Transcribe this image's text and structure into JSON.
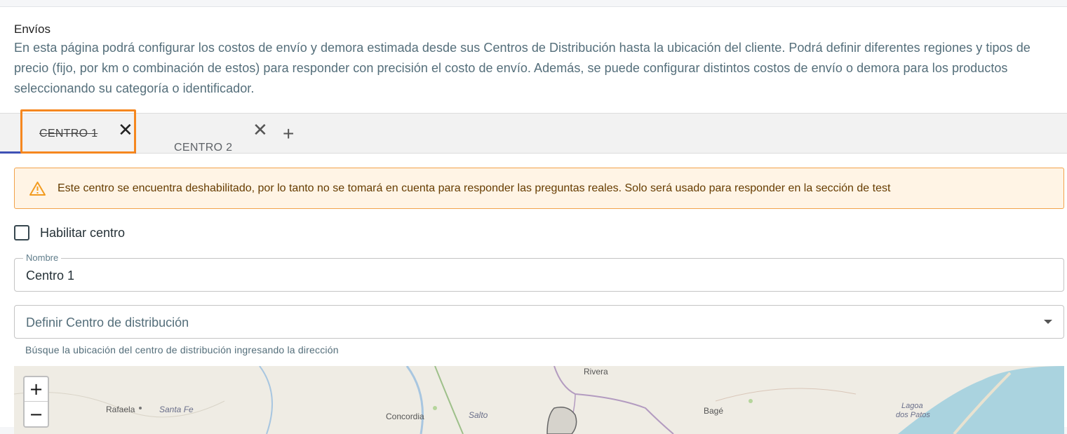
{
  "header": {
    "title": "Envíos",
    "description": "En esta página podrá configurar los costos de envío y demora estimada desde sus Centros de Distribución hasta la ubicación del cliente. Podrá definir diferentes regiones y tipos de precio (fijo, por km o combinación de estos) para responder con precisión el costo de envío. Además, se puede configurar distintos costos de envío o demora para los productos seleccionando su categoría o identificador."
  },
  "tabs": [
    {
      "label": "CENTRO 1",
      "close": "✕",
      "disabled": true,
      "selected": true
    },
    {
      "label": "CENTRO 2",
      "close": "✕",
      "disabled": false,
      "selected": false
    }
  ],
  "tab_add": "+",
  "alert": {
    "icon": "warning-icon",
    "text": "Este centro se encuentra deshabilitado, por lo tanto no se tomará en cuenta para responder las preguntas reales. Solo será usado para responder en la sección de test"
  },
  "enable_center": {
    "label": "Habilitar centro",
    "checked": false
  },
  "name_field": {
    "legend": "Nombre",
    "value": "Centro 1"
  },
  "distribution_select": {
    "placeholder": "Definir Centro de distribución",
    "helper": "Búsque la ubicación del centro de distribución ingresando la dirección"
  },
  "map": {
    "zoom_in": "+",
    "zoom_out": "−",
    "labels": {
      "rivera": "Rivera",
      "rafaela": "Rafaela",
      "santa_fe": "Santa Fe",
      "salto": "Salto",
      "concordia": "Concordia",
      "bage": "Bagé",
      "lagoa": "Lagoa",
      "dos_patos": "dos Patos",
      "rivera_partial": "Rivera"
    }
  },
  "colors": {
    "accent": "#3f51b5",
    "highlight": "#f5871f",
    "alert_bg": "#fff4e5",
    "alert_border": "#f2a24a"
  }
}
